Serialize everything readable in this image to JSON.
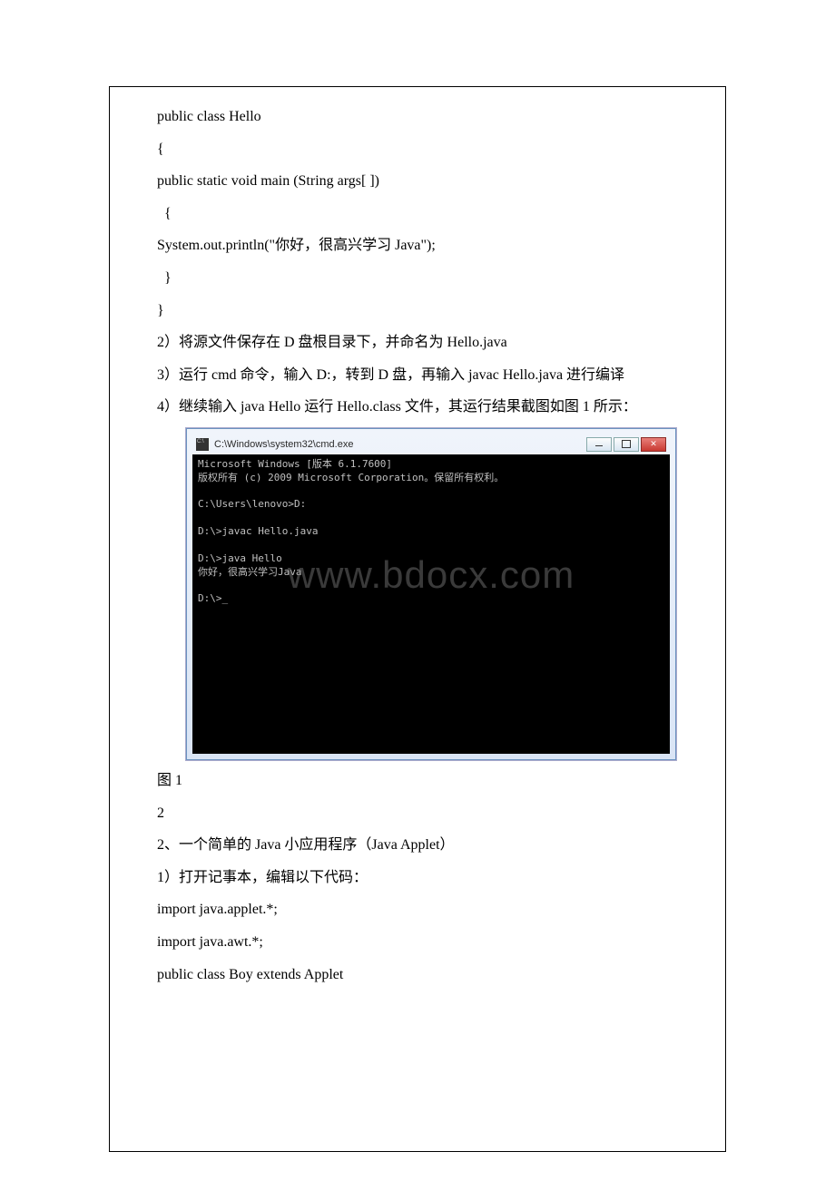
{
  "code1": {
    "l1": "public class Hello",
    "l2": "{",
    "l3": "public static void main (String args[ ])",
    "l4": "{",
    "l5": "System.out.println(\"你好，很高兴学习 Java\");",
    "l6": "}",
    "l7": "}"
  },
  "para": {
    "p2": "2）将源文件保存在 D 盘根目录下，并命名为 Hello.java",
    "p3": "3）运行 cmd 命令，输入 D:，转到 D 盘，再输入 javac Hello.java 进行编译",
    "p4": "4）继续输入 java Hello 运行 Hello.class 文件，其运行结果截图如图 1 所示：",
    "fig": "图 1",
    "num": "2",
    "s2": "2、一个简单的 Java 小应用程序（Java Applet）",
    "s2a": "1）打开记事本，编辑以下代码：",
    "c2a": "import java.applet.*;",
    "c2b": "import java.awt.*;",
    "c2c": "public class Boy extends Applet"
  },
  "terminal": {
    "title": "C:\\Windows\\system32\\cmd.exe",
    "l1": "Microsoft Windows [版本 6.1.7600]",
    "l2": "版权所有 (c) 2009 Microsoft Corporation。保留所有权利。",
    "l3": "",
    "l4": "C:\\Users\\lenovo>D:",
    "l5": "",
    "l6": "D:\\>javac Hello.java",
    "l7": "",
    "l8": "D:\\>java Hello",
    "l9": "你好，很高兴学习Java",
    "l10": "",
    "l11": "D:\\>_"
  },
  "watermark": "www.bdocx.com"
}
